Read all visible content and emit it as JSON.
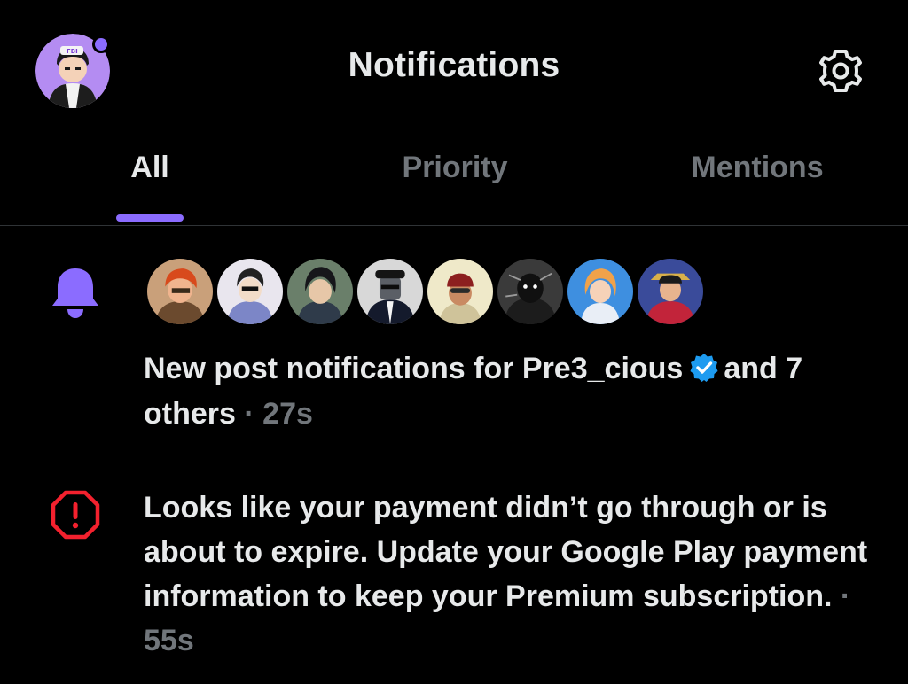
{
  "header": {
    "title": "Notifications",
    "avatar_icon": "profile-avatar",
    "settings_icon": "gear-icon",
    "accent": "#8b6cff"
  },
  "tabs": [
    {
      "label": "All",
      "active": true
    },
    {
      "label": "Priority",
      "active": false
    },
    {
      "label": "Mentions",
      "active": false
    }
  ],
  "notifications": [
    {
      "icon": "bell-icon",
      "icon_color": "#8b6cff",
      "avatar_count": 8,
      "text_lead": "New post notifications for Pre3_cious",
      "verified_icon": "verified-badge-icon",
      "text_tail": "and 7 others",
      "separator": "·",
      "time": "27s"
    },
    {
      "icon": "alert-octagon-icon",
      "icon_color": "#f4212e",
      "text": "Looks like your payment didn’t go through or is about to expire. Update your Google Play payment information to keep your Premium subscription.",
      "separator": "·",
      "time": "55s"
    }
  ]
}
